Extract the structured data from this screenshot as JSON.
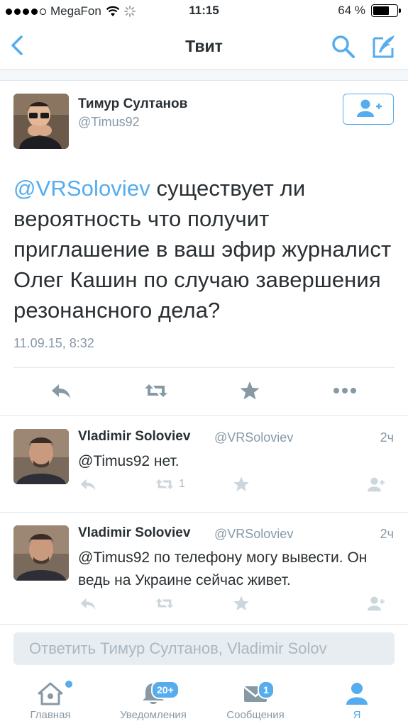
{
  "status_bar": {
    "carrier": "MegaFon",
    "time": "11:15",
    "battery": "64 %"
  },
  "nav": {
    "title": "Твит"
  },
  "main_tweet": {
    "author_name": "Тимур Султанов",
    "author_handle": "@Timus92",
    "mention": "@VRSoloviev",
    "text": " существует ли вероятность что получит приглашение в ваш эфир журналист Олег Кашин по случаю завершения резонансного дела?",
    "date": "11.09.15, 8:32"
  },
  "replies": [
    {
      "name": "Vladimir Soloviev",
      "handle": "@VRSoloviev",
      "time": "2ч",
      "text": "@Timus92 нет.",
      "retweets": "1"
    },
    {
      "name": "Vladimir Soloviev",
      "handle": "@VRSoloviev",
      "time": "2ч",
      "text": "@Timus92 по телефону могу вывести. Он ведь на Украине сейчас живет.",
      "retweets": ""
    }
  ],
  "compose": {
    "placeholder": "Ответить Тимур Султанов, Vladimir Solov"
  },
  "tabs": [
    {
      "label": "Главная",
      "icon": "home-icon"
    },
    {
      "label": "Уведомления",
      "icon": "bell-icon",
      "badge": "20+"
    },
    {
      "label": "Сообщения",
      "icon": "envelope-icon",
      "badge": "1"
    },
    {
      "label": "Я",
      "icon": "person-icon"
    }
  ],
  "colors": {
    "accent": "#55acee",
    "text": "#292f33",
    "muted": "#8899a6"
  }
}
